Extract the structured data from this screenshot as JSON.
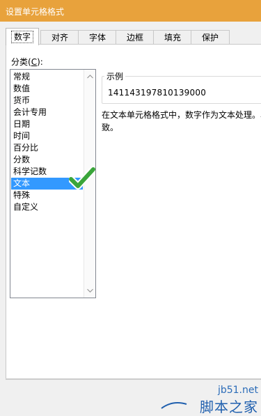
{
  "window": {
    "title": "设置单元格格式"
  },
  "tabs": [
    {
      "label": "数字",
      "active": true
    },
    {
      "label": "对齐",
      "active": false
    },
    {
      "label": "字体",
      "active": false
    },
    {
      "label": "边框",
      "active": false
    },
    {
      "label": "填充",
      "active": false
    },
    {
      "label": "保护",
      "active": false
    }
  ],
  "category": {
    "label_prefix": "分类(",
    "label_key": "C",
    "label_suffix": "):",
    "items": [
      "常规",
      "数值",
      "货币",
      "会计专用",
      "日期",
      "时间",
      "百分比",
      "分数",
      "科学记数",
      "文本",
      "特殊",
      "自定义"
    ],
    "selected": "文本"
  },
  "sample": {
    "legend": "示例",
    "value": "141143197810139000"
  },
  "description": {
    "line1": "在文本单元格格式中，数字作为文本处理。单",
    "line2": "致。"
  },
  "icons": {
    "checkmark": "green-checkmark-icon",
    "scroll_up": "scroll-up-arrow-icon",
    "scroll_down": "scroll-down-arrow-icon"
  },
  "watermark": {
    "url": "jb51.net",
    "name": "脚本之家"
  },
  "colors": {
    "titlebar": "#e8a23c",
    "selection": "#3399ff",
    "checkmark": "#3aa53a"
  }
}
